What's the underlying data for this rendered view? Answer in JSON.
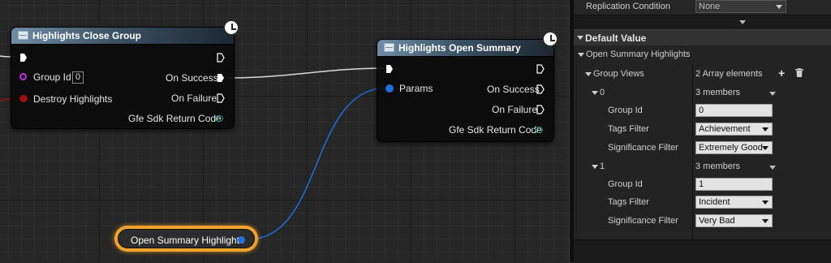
{
  "nodes": {
    "close_group": {
      "title": "Highlights Close Group",
      "group_id_label": "Group Id",
      "group_id_value": "0",
      "destroy_label": "Destroy Highlights",
      "on_success": "On Success",
      "on_failure": "On Failure",
      "return_code": "Gfe Sdk Return Code"
    },
    "open_summary": {
      "title": "Highlights Open Summary",
      "params_label": "Params",
      "on_success": "On Success",
      "on_failure": "On Failure",
      "return_code": "Gfe Sdk Return Code"
    },
    "variable": {
      "label": "Open Summary Highlights"
    }
  },
  "details": {
    "replication_label": "Replication Condition",
    "replication_value": "None",
    "section_title": "Default Value",
    "variable_name": "Open Summary Highlights",
    "group_views_label": "Group Views",
    "group_views_value": "2 Array elements",
    "elements": [
      {
        "index": "0",
        "members": "3 members",
        "group_id_label": "Group Id",
        "group_id_value": "0",
        "tags_label": "Tags Filter",
        "tags_value": "Achievement",
        "significance_label": "Significance Filter",
        "significance_value": "Extremely Good"
      },
      {
        "index": "1",
        "members": "3 members",
        "group_id_label": "Group Id",
        "group_id_value": "1",
        "tags_label": "Tags Filter",
        "tags_value": "Incident",
        "significance_label": "Significance Filter",
        "significance_value": "Very Bad"
      }
    ]
  },
  "colors": {
    "exec_wire": "#d8d8d8",
    "struct_wire": "#1e6ee0",
    "object_pin": "#c02de0",
    "bool_pin": "#9a0f0f",
    "return_pin": "#1f9a88",
    "variable_glow": "#f0a32c"
  },
  "icons": [
    "clock-icon",
    "function-icon",
    "exec-pin-icon",
    "add-icon",
    "trash-icon",
    "collapse-arrow-icon"
  ]
}
